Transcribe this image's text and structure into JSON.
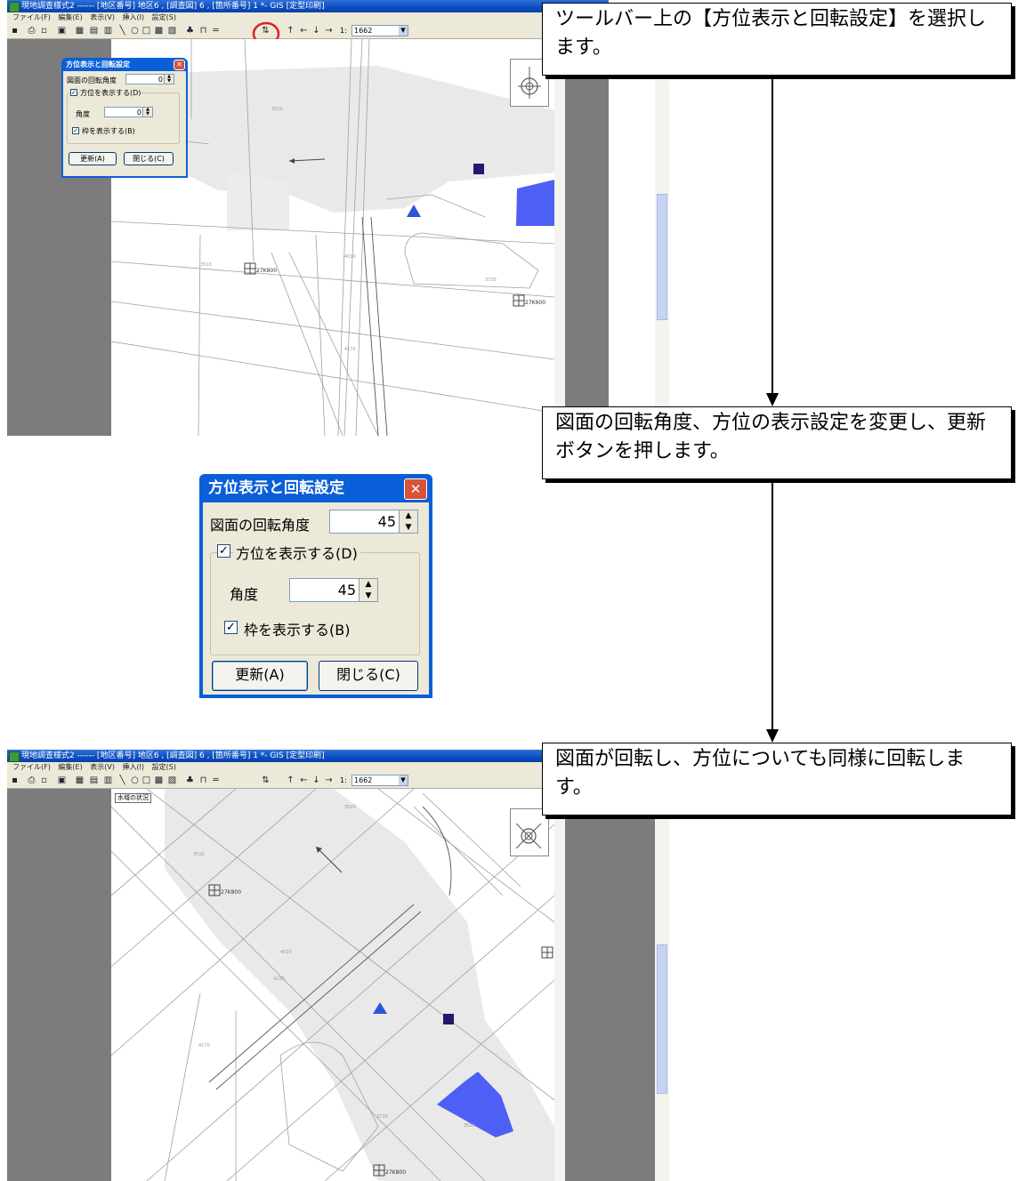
{
  "app": {
    "title": "現地調査様式2 ------ [地区番号] 地区6 , [調査図] 6 , [箇所番号] 1 *- GIS [定型印刷]",
    "menu": [
      "ファイル(F)",
      "編集(E)",
      "表示(V)",
      "挿入(I)",
      "設定(S)"
    ],
    "scale_prefix": "1:",
    "scale_value": "1662",
    "map_label": "水域の状況"
  },
  "map_labels": {
    "station_a": "27K800",
    "station_b": "27K600",
    "num_1": "3520",
    "num_2": "3510",
    "num_3": "4010",
    "num_4": "3720",
    "num_5": "4170",
    "num_6": "4210"
  },
  "dialog": {
    "title": "方位表示と回転設定",
    "rotation_label": "図面の回転角度",
    "rotation_small": "0",
    "rotation_value": "45",
    "show_direction_label": "方位を表示する(D)",
    "show_direction_checked": true,
    "angle_label": "角度",
    "angle_small": "0",
    "angle_value": "45",
    "show_frame_label": "枠を表示する(B)",
    "show_frame_checked": true,
    "update_button": "更新(A)",
    "close_button": "閉じる(C)"
  },
  "callouts": {
    "step1": "ツールバー上の【方位表示と回転設定】を選択します。",
    "step2": "図面の回転角度、方位の表示設定を変更し、更新ボタンを押します。",
    "step3": "図面が回転し、方位についても同様に回転します。"
  },
  "icons": {
    "save": "save-icon",
    "print": "print-icon",
    "preview": "print-preview-icon",
    "direction": "direction-rotate-icon",
    "compass": "compass-icon",
    "up": "arrow-up-icon",
    "left": "arrow-left-icon",
    "down": "arrow-down-icon",
    "right": "arrow-right-icon"
  },
  "colors": {
    "highlight_circle": "#e02020",
    "map_polygon": "#4d5ff5",
    "map_triangle": "#2b55d8",
    "map_square": "#1f1a6e",
    "xp_title": "#0a5fd8"
  }
}
